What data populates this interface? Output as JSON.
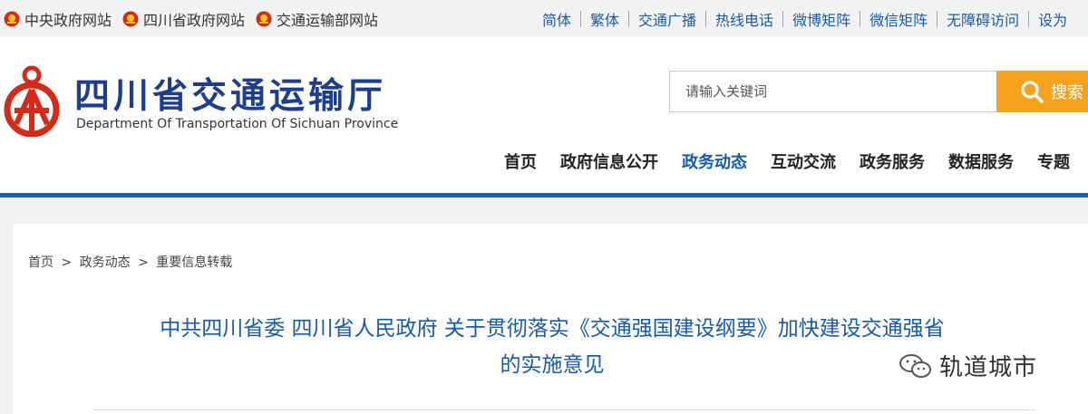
{
  "topbar": {
    "links": [
      {
        "label": "中央政府网站"
      },
      {
        "label": "四川省政府网站"
      },
      {
        "label": "交通运输部网站"
      }
    ],
    "right_links": [
      {
        "label": "简体"
      },
      {
        "label": "繁体"
      },
      {
        "label": "交通广播"
      },
      {
        "label": "热线电话"
      },
      {
        "label": "微博矩阵"
      },
      {
        "label": "微信矩阵"
      },
      {
        "label": "无障碍访问"
      },
      {
        "label": "设为"
      }
    ]
  },
  "header": {
    "title": "四川省交通运输厅",
    "subtitle": "Department Of Transportation Of Sichuan Province",
    "logo_color": "#d42a1a"
  },
  "search": {
    "placeholder": "请输入关键词",
    "button_label": "搜索",
    "button_color": "#f5a31c"
  },
  "nav": {
    "items": [
      {
        "label": "首页"
      },
      {
        "label": "政府信息公开"
      },
      {
        "label": "政务动态"
      },
      {
        "label": "互动交流"
      },
      {
        "label": "政务服务"
      },
      {
        "label": "数据服务"
      },
      {
        "label": "专题"
      }
    ],
    "active_index": 2,
    "accent": "#1d5fb4"
  },
  "breadcrumb": {
    "items": [
      "首页",
      "政务动态",
      "重要信息转载"
    ],
    "separator": ">"
  },
  "article": {
    "title_line1": "中共四川省委 四川省人民政府 关于贯彻落实《交通强国建设纲要》加快建设交通强省",
    "title_line2": "的实施意见"
  },
  "watermark": {
    "text": "轨道城市",
    "icon": "wechat-icon"
  }
}
